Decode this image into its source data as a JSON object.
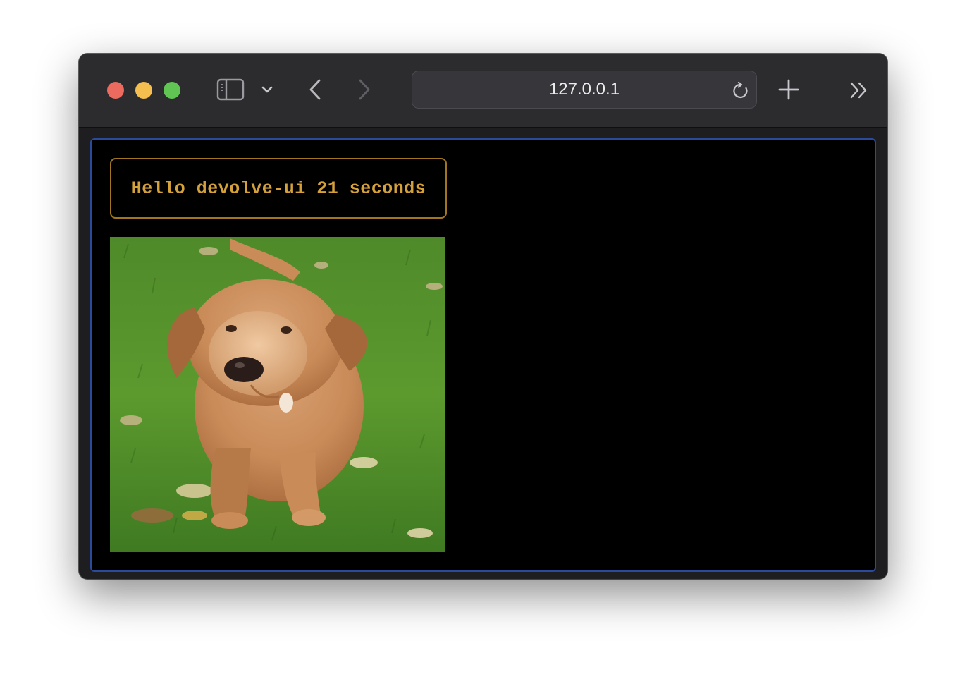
{
  "browser": {
    "url": "127.0.0.1",
    "icons": {
      "sidebar": "sidebar-icon",
      "chevron": "chevron-down-icon",
      "back": "back-arrow-icon",
      "forward": "forward-arrow-icon",
      "reload": "reload-icon",
      "new_tab": "plus-icon",
      "overflow": "double-chevron-right-icon"
    },
    "traffic_colors": {
      "close": "#ed6a5e",
      "minimize": "#f5bf4f",
      "maximize": "#61c554"
    }
  },
  "page": {
    "greeting": "Hello devolve-ui 21 seconds",
    "greeting_color": "#d4a13a",
    "border_color": "#a2751f",
    "image": {
      "subject": "puppy-on-grass"
    }
  }
}
